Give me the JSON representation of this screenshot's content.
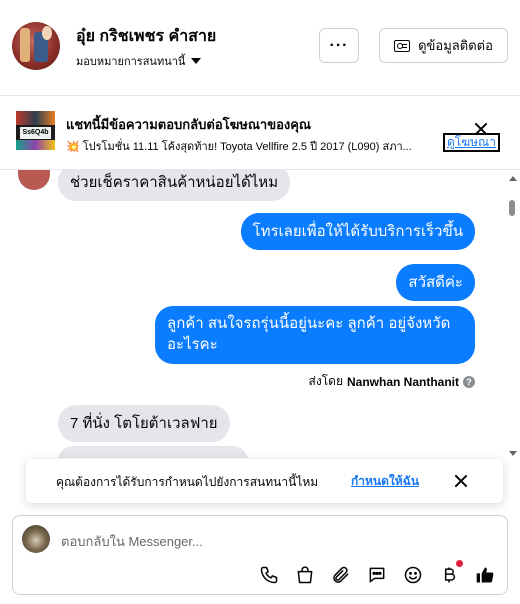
{
  "header": {
    "name": "อุ๋ย กริชเพชร คำสาย",
    "assign_label": "มอบหมายการสนทนานี้",
    "more_label": "···",
    "contact_info_label": "ดูข้อมูลติดต่อ"
  },
  "ad_banner": {
    "thumb_text": "Ss6Q4b",
    "title": "แชทนี้มีข้อความตอบกลับต่อโฆษณาของคุณ",
    "description": "💥 โปรโมชั่น 11.11 โค้งสุดท้าย! Toyota Vellfire 2.5 ปี 2017 (L090) สภา...",
    "view_ad_label": "ดูโฆษณา"
  },
  "messages": [
    {
      "direction": "in",
      "text": "ช่วยเช็คราคาสินค้าหน่อยได้ไหม"
    },
    {
      "direction": "out",
      "text": "โทรเลยเพื่อให้ได้รับบริการเร็วขึ้น"
    },
    {
      "direction": "out",
      "text": "สวัสดีค่ะ"
    },
    {
      "direction": "out",
      "line1": "ลูกค้า  สนใจรถรุ่นนี้อยู่นะคะ  ลูกค้า อยู่จังหวัด",
      "line2": "อะไรคะ"
    },
    {
      "direction": "in",
      "text": "7 ที่นั่ง โตโยต้าเวลฟาย"
    }
  ],
  "sent_by": {
    "prefix": "ส่งโดย",
    "name": "Nanwhan Nanthanit",
    "help": "?"
  },
  "reminder": {
    "text": "คุณต้องการได้รับการกำหนดไปยังการสนทนานี้ไหม",
    "link": "กำหนดให้ฉัน"
  },
  "composer": {
    "placeholder": "ตอบกลับใน Messenger...",
    "tools": [
      "phone-icon",
      "shopping-bag-icon",
      "paperclip-icon",
      "saved-reply-icon",
      "emoji-icon",
      "baht-icon",
      "like-icon"
    ]
  },
  "colors": {
    "outgoing_bubble": "#0a7cff",
    "incoming_bubble": "#e4e6eb",
    "link": "#1877f2",
    "notification_dot": "#e41e3f"
  }
}
